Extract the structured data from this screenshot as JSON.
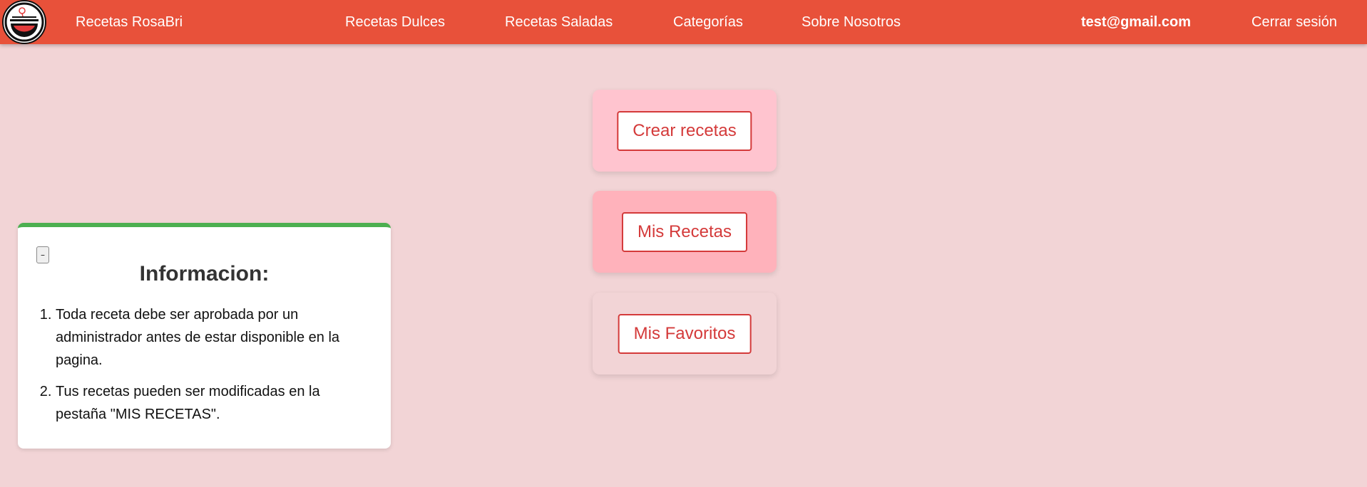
{
  "navbar": {
    "brand": "Recetas RosaBri",
    "links": [
      "Recetas Dulces",
      "Recetas Saladas",
      "Categorías",
      "Sobre Nosotros"
    ],
    "user_email": "test@gmail.com",
    "logout": "Cerrar sesión",
    "bg_color": "#e8513a"
  },
  "cards": [
    {
      "label": "Crear recetas",
      "bg": "#ffc4cf"
    },
    {
      "label": "Mis Recetas",
      "bg": "#ffb2bb"
    },
    {
      "label": "Mis Favoritos",
      "bg": "#f2d4d6"
    }
  ],
  "info": {
    "toggle": "–",
    "title": "Informacion:",
    "items": [
      "Toda receta debe ser aprobada por un administrador antes de estar disponible en la pagina.",
      "Tus recetas pueden ser modificadas en la pestaña \"MIS RECETAS\"."
    ],
    "accent": "#4caf50"
  },
  "page_bg": "#f2d4d6",
  "logo_icon": "chef-hat-bowl-icon"
}
